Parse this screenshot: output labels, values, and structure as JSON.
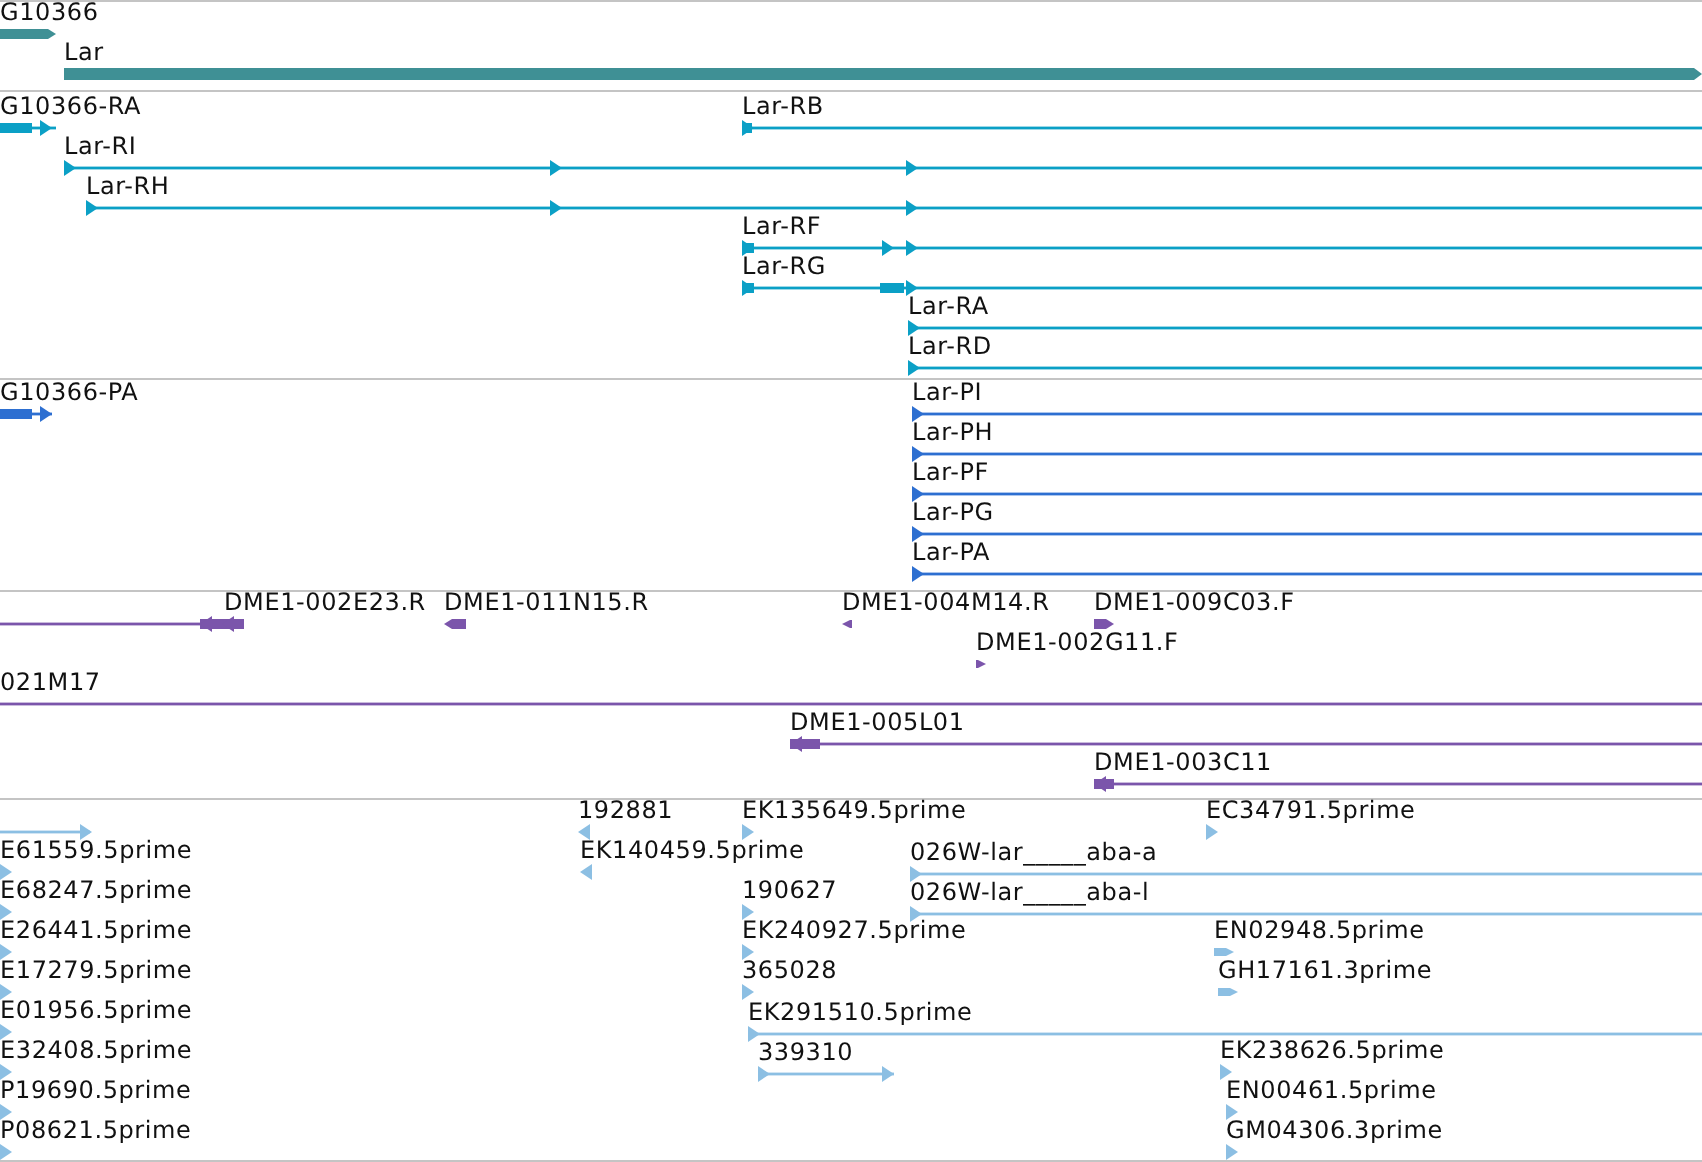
{
  "tracks": [
    {
      "color": "#3f9095",
      "features": [
        {
          "label": "G10366",
          "reverse": false
        },
        {
          "label": "Lar",
          "reverse": false
        }
      ]
    },
    {
      "color": "#0ba0c6",
      "features": [
        {
          "label": "G10366-RA",
          "reverse": false
        },
        {
          "label": "Lar-RB",
          "reverse": false
        },
        {
          "label": "Lar-RI",
          "reverse": false
        },
        {
          "label": "Lar-RH",
          "reverse": false
        },
        {
          "label": "Lar-RF",
          "reverse": false
        },
        {
          "label": "Lar-RG",
          "reverse": false
        },
        {
          "label": "Lar-RA",
          "reverse": false
        },
        {
          "label": "Lar-RD",
          "reverse": false
        }
      ]
    },
    {
      "color": "#2d6fd1",
      "features": [
        {
          "label": "G10366-PA",
          "reverse": false
        },
        {
          "label": "Lar-PI",
          "reverse": false
        },
        {
          "label": "Lar-PH",
          "reverse": false
        },
        {
          "label": "Lar-PF",
          "reverse": false
        },
        {
          "label": "Lar-PG",
          "reverse": false
        },
        {
          "label": "Lar-PA",
          "reverse": false
        }
      ]
    },
    {
      "color": "#7b55ab",
      "features": [
        {
          "label": "DME1-002E23.R",
          "reverse": true
        },
        {
          "label": "DME1-011N15.R",
          "reverse": true
        },
        {
          "label": "DME1-004M14.R",
          "reverse": true
        },
        {
          "label": "DME1-009C03.F",
          "reverse": false
        },
        {
          "label": "DME1-002G11.F",
          "reverse": false
        },
        {
          "label": "021M17"
        },
        {
          "label": "DME1-005L01",
          "reverse": true
        },
        {
          "label": "DME1-003C11",
          "reverse": true
        }
      ]
    },
    {
      "color": "#8cbfe3",
      "features": [
        {
          "reverse": false
        },
        {
          "label": "E61559.5prime",
          "reverse": false
        },
        {
          "label": "E68247.5prime",
          "reverse": false
        },
        {
          "label": "E26441.5prime",
          "reverse": false
        },
        {
          "label": "E17279.5prime",
          "reverse": false
        },
        {
          "label": "E01956.5prime",
          "reverse": false
        },
        {
          "label": "E32408.5prime",
          "reverse": false
        },
        {
          "label": "P19690.5prime",
          "reverse": false
        },
        {
          "label": "P08621.5prime",
          "reverse": false
        },
        {
          "label": "192881",
          "reverse": true
        },
        {
          "label": "EK140459.5prime",
          "reverse": true
        },
        {
          "label": "EK135649.5prime",
          "reverse": false
        },
        {
          "label": "190627",
          "reverse": false
        },
        {
          "label": "EK240927.5prime",
          "reverse": false
        },
        {
          "label": "365028",
          "reverse": false
        },
        {
          "label": "EK291510.5prime",
          "reverse": false
        },
        {
          "label": "339310",
          "reverse": false
        },
        {
          "label": "026W-lar_____aba-a",
          "reverse": false
        },
        {
          "label": "026W-lar_____aba-l",
          "reverse": false
        },
        {
          "label": "EC34791.5prime",
          "reverse": false
        },
        {
          "label": "EN02948.5prime",
          "reverse": false
        },
        {
          "label": "GH17161.3prime",
          "reverse": false
        },
        {
          "label": "EK238626.5prime",
          "reverse": false
        },
        {
          "label": "EN00461.5prime",
          "reverse": false
        },
        {
          "label": "GM04306.3prime",
          "reverse": false
        }
      ]
    }
  ]
}
